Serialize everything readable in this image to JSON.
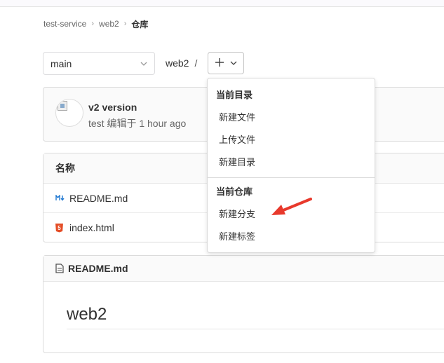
{
  "breadcrumb": {
    "items": [
      "test-service",
      "web2"
    ],
    "current": "仓库"
  },
  "branch": {
    "selected": "main"
  },
  "path": {
    "dir": "web2",
    "slash": "/"
  },
  "commit": {
    "title": "v2 version",
    "meta": "test 编辑于 1 hour ago"
  },
  "table": {
    "header": "名称",
    "files": [
      {
        "name": "README.md",
        "icon": "markdown-icon"
      },
      {
        "name": "index.html",
        "icon": "html5-icon"
      }
    ]
  },
  "readme": {
    "filename": "README.md",
    "heading": "web2"
  },
  "dropdown": {
    "section1_title": "当前目录",
    "section1_items": [
      "新建文件",
      "上传文件",
      "新建目录"
    ],
    "section2_title": "当前仓库",
    "section2_items": [
      "新建分支",
      "新建标签"
    ]
  },
  "colors": {
    "annotation_arrow": "#e8392c",
    "link": "#1f78d1"
  }
}
